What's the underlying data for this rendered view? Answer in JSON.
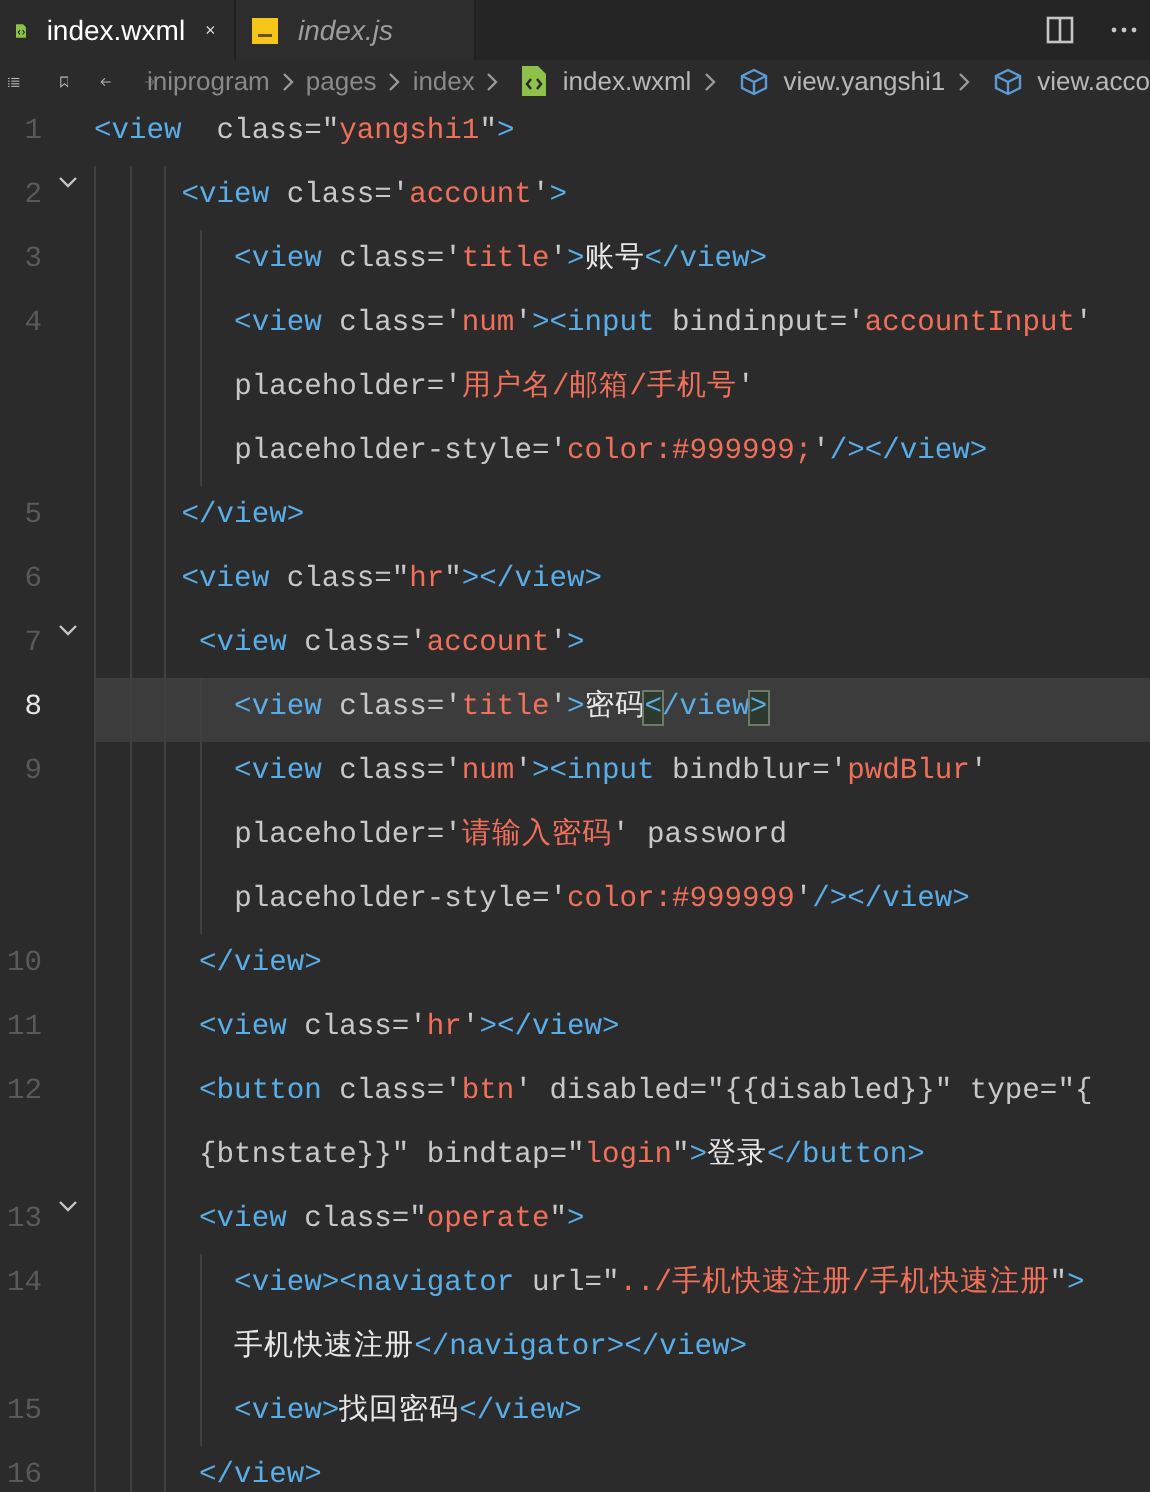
{
  "tabs": [
    {
      "label": "index.wxml",
      "kind": "wxml",
      "selected": true,
      "preview": false
    },
    {
      "label": "index.js",
      "kind": "js",
      "selected": false,
      "preview": true
    }
  ],
  "breadcrumbs": [
    {
      "label": "iniprogram",
      "kind": "folder"
    },
    {
      "label": "pages",
      "kind": "folder"
    },
    {
      "label": "index",
      "kind": "folder"
    },
    {
      "label": "index.wxml",
      "kind": "file"
    },
    {
      "label": "view.yangshi1",
      "kind": "symbol"
    },
    {
      "label": "view.acco",
      "kind": "symbol"
    }
  ],
  "lines": [
    {
      "number": "1",
      "fold": false,
      "current": false,
      "rows": [
        {
          "segments": [
            {
              "kind": "tag",
              "text": "<view"
            },
            {
              "kind": "attr",
              "text": "  class=\""
            },
            {
              "kind": "str",
              "text": "yangshi1"
            },
            {
              "kind": "attr",
              "text": "\""
            },
            {
              "kind": "tag",
              "text": ">"
            }
          ]
        }
      ]
    },
    {
      "number": "2",
      "fold": true,
      "current": false,
      "rows": [
        {
          "segments": [
            {
              "kind": "tag",
              "text": "     <view"
            },
            {
              "kind": "attr",
              "text": " class='"
            },
            {
              "kind": "str",
              "text": "account"
            },
            {
              "kind": "attr",
              "text": "'"
            },
            {
              "kind": "tag",
              "text": ">"
            }
          ]
        }
      ]
    },
    {
      "number": "3",
      "fold": false,
      "current": false,
      "rows": [
        {
          "segments": [
            {
              "kind": "tag",
              "text": "        <view"
            },
            {
              "kind": "attr",
              "text": " class='"
            },
            {
              "kind": "str",
              "text": "title"
            },
            {
              "kind": "attr",
              "text": "'"
            },
            {
              "kind": "tag",
              "text": ">"
            },
            {
              "kind": "text",
              "text": "账号"
            },
            {
              "kind": "tag",
              "text": "</view>"
            }
          ]
        }
      ]
    },
    {
      "number": "4",
      "fold": false,
      "current": false,
      "rows": [
        {
          "segments": [
            {
              "kind": "tag",
              "text": "        <view"
            },
            {
              "kind": "attr",
              "text": " class='"
            },
            {
              "kind": "str",
              "text": "num"
            },
            {
              "kind": "attr",
              "text": "'"
            },
            {
              "kind": "tag",
              "text": "><input"
            },
            {
              "kind": "attr",
              "text": " bindinput='"
            },
            {
              "kind": "str",
              "text": "accountInput"
            },
            {
              "kind": "attr",
              "text": "'"
            }
          ]
        },
        {
          "segments": [
            {
              "kind": "attr",
              "text": "placeholder='"
            },
            {
              "kind": "str",
              "text": "用户名/邮箱/手机号"
            },
            {
              "kind": "attr",
              "text": "'"
            }
          ]
        },
        {
          "segments": [
            {
              "kind": "attr",
              "text": "placeholder-style='"
            },
            {
              "kind": "str",
              "text": "color:#999999;"
            },
            {
              "kind": "attr",
              "text": "'"
            },
            {
              "kind": "tag",
              "text": "/></view>"
            }
          ]
        }
      ]
    },
    {
      "number": "5",
      "fold": false,
      "current": false,
      "rows": [
        {
          "segments": [
            {
              "kind": "tag",
              "text": "     </view>"
            }
          ]
        }
      ]
    },
    {
      "number": "6",
      "fold": false,
      "current": false,
      "rows": [
        {
          "segments": [
            {
              "kind": "tag",
              "text": "     <view"
            },
            {
              "kind": "attr",
              "text": " class=\""
            },
            {
              "kind": "str",
              "text": "hr"
            },
            {
              "kind": "attr",
              "text": "\""
            },
            {
              "kind": "tag",
              "text": "></view>"
            }
          ]
        }
      ]
    },
    {
      "number": "7",
      "fold": true,
      "current": false,
      "rows": [
        {
          "segments": [
            {
              "kind": "tag",
              "text": "      <view"
            },
            {
              "kind": "attr",
              "text": " class='"
            },
            {
              "kind": "str",
              "text": "account"
            },
            {
              "kind": "attr",
              "text": "'"
            },
            {
              "kind": "tag",
              "text": ">"
            }
          ]
        }
      ]
    },
    {
      "number": "8",
      "fold": false,
      "current": true,
      "rows": [
        {
          "segments": [
            {
              "kind": "tag",
              "text": "        <view"
            },
            {
              "kind": "attr",
              "text": " class='"
            },
            {
              "kind": "str",
              "text": "title"
            },
            {
              "kind": "attr",
              "text": "'"
            },
            {
              "kind": "tag",
              "text": ">"
            },
            {
              "kind": "text",
              "text": "密码"
            },
            {
              "kind": "match",
              "text": "<"
            },
            {
              "kind": "tag",
              "text": "/view"
            },
            {
              "kind": "match",
              "text": ">"
            }
          ]
        }
      ]
    },
    {
      "number": "9",
      "fold": false,
      "current": false,
      "rows": [
        {
          "segments": [
            {
              "kind": "tag",
              "text": "        <view"
            },
            {
              "kind": "attr",
              "text": " class='"
            },
            {
              "kind": "str",
              "text": "num"
            },
            {
              "kind": "attr",
              "text": "'"
            },
            {
              "kind": "tag",
              "text": "><input"
            },
            {
              "kind": "attr",
              "text": " bindblur='"
            },
            {
              "kind": "str",
              "text": "pwdBlur"
            },
            {
              "kind": "attr",
              "text": "'"
            }
          ]
        },
        {
          "segments": [
            {
              "kind": "attr",
              "text": "placeholder='"
            },
            {
              "kind": "str",
              "text": "请输入密码"
            },
            {
              "kind": "attr",
              "text": "' password"
            }
          ]
        },
        {
          "segments": [
            {
              "kind": "attr",
              "text": "placeholder-style='"
            },
            {
              "kind": "str",
              "text": "color:#999999"
            },
            {
              "kind": "attr",
              "text": "'"
            },
            {
              "kind": "tag",
              "text": "/></view>"
            }
          ]
        }
      ]
    },
    {
      "number": "10",
      "fold": false,
      "current": false,
      "rows": [
        {
          "segments": [
            {
              "kind": "tag",
              "text": "      </view>"
            }
          ]
        }
      ]
    },
    {
      "number": "11",
      "fold": false,
      "current": false,
      "rows": [
        {
          "segments": [
            {
              "kind": "tag",
              "text": "      <view"
            },
            {
              "kind": "attr",
              "text": " class='"
            },
            {
              "kind": "str",
              "text": "hr"
            },
            {
              "kind": "attr",
              "text": "'"
            },
            {
              "kind": "tag",
              "text": "></view>"
            }
          ]
        }
      ]
    },
    {
      "number": "12",
      "fold": false,
      "current": false,
      "rows": [
        {
          "segments": [
            {
              "kind": "tag",
              "text": "      <button"
            },
            {
              "kind": "attr",
              "text": " class='"
            },
            {
              "kind": "str",
              "text": "btn"
            },
            {
              "kind": "attr",
              "text": "' disabled=\"{{disabled}}\" type=\"{"
            }
          ]
        },
        {
          "segments": [
            {
              "kind": "attr",
              "text": "{btnstate}}\" bindtap=\""
            },
            {
              "kind": "str",
              "text": "login"
            },
            {
              "kind": "attr",
              "text": "\""
            },
            {
              "kind": "tag",
              "text": ">"
            },
            {
              "kind": "text",
              "text": "登录"
            },
            {
              "kind": "tag",
              "text": "</button>"
            }
          ]
        }
      ]
    },
    {
      "number": "13",
      "fold": true,
      "current": false,
      "rows": [
        {
          "segments": [
            {
              "kind": "tag",
              "text": "      <view"
            },
            {
              "kind": "attr",
              "text": " class=\""
            },
            {
              "kind": "str",
              "text": "operate"
            },
            {
              "kind": "attr",
              "text": "\""
            },
            {
              "kind": "tag",
              "text": ">"
            }
          ]
        }
      ]
    },
    {
      "number": "14",
      "fold": false,
      "current": false,
      "rows": [
        {
          "segments": [
            {
              "kind": "tag",
              "text": "        <view><navigator"
            },
            {
              "kind": "attr",
              "text": " url=\""
            },
            {
              "kind": "str",
              "text": "../手机快速注册/手机快速注册"
            },
            {
              "kind": "attr",
              "text": "\""
            },
            {
              "kind": "tag",
              "text": ">"
            }
          ]
        },
        {
          "segments": [
            {
              "kind": "text",
              "text": "手机快速注册"
            },
            {
              "kind": "tag",
              "text": "</navigator></view>"
            }
          ]
        }
      ]
    },
    {
      "number": "15",
      "fold": false,
      "current": false,
      "rows": [
        {
          "segments": [
            {
              "kind": "tag",
              "text": "        <view>"
            },
            {
              "kind": "text",
              "text": "找回密码"
            },
            {
              "kind": "tag",
              "text": "</view>"
            }
          ]
        }
      ]
    },
    {
      "number": "16",
      "fold": false,
      "current": false,
      "rows": [
        {
          "segments": [
            {
              "kind": "tag",
              "text": "      </view>"
            }
          ]
        }
      ]
    }
  ]
}
